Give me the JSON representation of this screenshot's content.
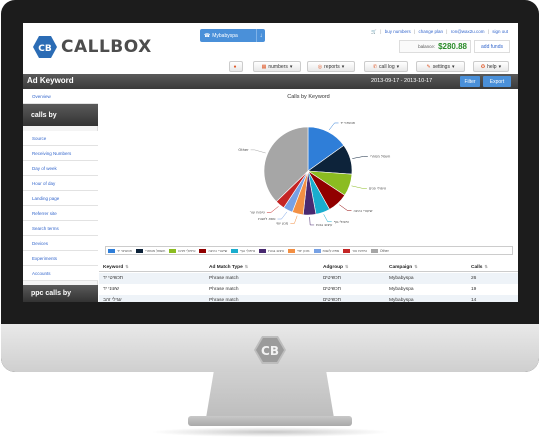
{
  "app": {
    "logo_text": "CALLBOX",
    "account_button": "Mybabyspa",
    "top_links": [
      "buy numbers",
      "change plan",
      "ron@wax2u.com",
      "sign out"
    ],
    "balance_label": "balance:",
    "balance_value": "$280.88",
    "add_funds": "add funds"
  },
  "nav": {
    "items": [
      {
        "label": "",
        "icon": "chat-bubble-icon"
      },
      {
        "label": "numbers",
        "icon": "grid-icon"
      },
      {
        "label": "reports",
        "icon": "target-icon"
      },
      {
        "label": "call log",
        "icon": "phone-icon"
      },
      {
        "label": "settings",
        "icon": "wrench-icon"
      },
      {
        "label": "help",
        "icon": "lifebuoy-icon"
      }
    ]
  },
  "titlebar": {
    "title": "Ad Keyword",
    "date_range": "2013-09-17 - 2013-10-17",
    "filter": "Filter",
    "export": "Export"
  },
  "sidebar": {
    "overview": "Overview",
    "calls_by_header": "calls by",
    "calls_by_items": [
      "Source",
      "Receiving Numbers",
      "Day of week",
      "Hour of day",
      "Landing page",
      "Referrer site",
      "Search terms",
      "Devices",
      "Experiments",
      "Accounts"
    ],
    "ppc_header": "ppc calls by"
  },
  "chart_data": {
    "type": "pie",
    "title": "Calls by Keyword",
    "series": [
      {
        "name": "תכשיטי יד",
        "value": 26,
        "color": "#2f7ed8"
      },
      {
        "name": "חשמל מסחרי",
        "value": 19,
        "color": "#0d233a"
      },
      {
        "name": "טיפולי פנים",
        "value": 14,
        "color": "#8bbc21"
      },
      {
        "name": "שיעורי נהיגה",
        "value": 13,
        "color": "#910000"
      },
      {
        "name": "טיפולי גוף",
        "value": 9,
        "color": "#1aadce"
      },
      {
        "name": "עיצוב גבות",
        "value": 8,
        "color": "#492970"
      },
      {
        "name": "מכון יופי",
        "value": 7,
        "color": "#f28f43"
      },
      {
        "name": "ספא לזוגות",
        "value": 6,
        "color": "#77a1e5"
      },
      {
        "name": "טיפוח עור",
        "value": 6,
        "color": "#c42525"
      },
      {
        "name": "Other",
        "value": 64,
        "color": "#a6a6a6"
      }
    ]
  },
  "table": {
    "headers": [
      "Keyword",
      "Ad Match Type",
      "Adgroup",
      "Campaign",
      "Calls"
    ],
    "rows": [
      [
        "תכשיטי יד",
        "Phrase match",
        "תכשיטים",
        "Mybabyspa",
        "26"
      ],
      [
        "שעוני יד",
        "Phrase match",
        "תכשיטים",
        "Mybabyspa",
        "19"
      ],
      [
        "עגילי זהב",
        "Phrase match",
        "תכשיטים",
        "Mybabyspa",
        "14"
      ],
      [
        "צמידי כסף",
        "Phrase match",
        "תכשיטים",
        "Mybabyspa",
        "13"
      ]
    ]
  }
}
